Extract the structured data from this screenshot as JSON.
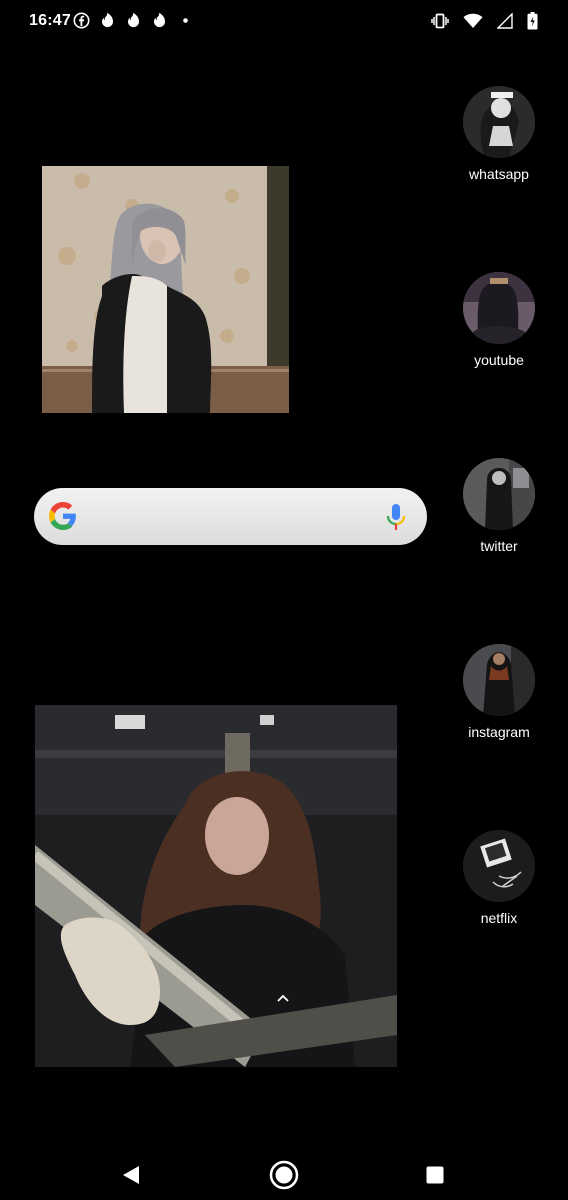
{
  "status_bar": {
    "time": "16:47",
    "notification_icons": [
      "facebook-icon",
      "tinder-icon",
      "tinder-icon",
      "tinder-icon",
      "dot-icon"
    ],
    "system_icons": [
      "vibrate-icon",
      "wifi-icon",
      "signal-icon",
      "battery-icon"
    ]
  },
  "search": {
    "logo": "google-logo-icon",
    "mic_icon": "mic-icon"
  },
  "apps": [
    {
      "label": "whatsapp",
      "icon": "whatsapp-photo-icon"
    },
    {
      "label": "youtube",
      "icon": "youtube-photo-icon"
    },
    {
      "label": "twitter",
      "icon": "twitter-photo-icon"
    },
    {
      "label": "instagram",
      "icon": "instagram-photo-icon"
    },
    {
      "label": "netflix",
      "icon": "netflix-photo-icon"
    }
  ],
  "nav": {
    "back": "back-icon",
    "home": "home-icon",
    "recents": "recents-icon"
  },
  "colors": {
    "background": "#000000",
    "search_bar": "#e6e6e6",
    "google_blue": "#4285F4",
    "google_red": "#EA4335",
    "google_yellow": "#FBBC05",
    "google_green": "#34A853"
  }
}
